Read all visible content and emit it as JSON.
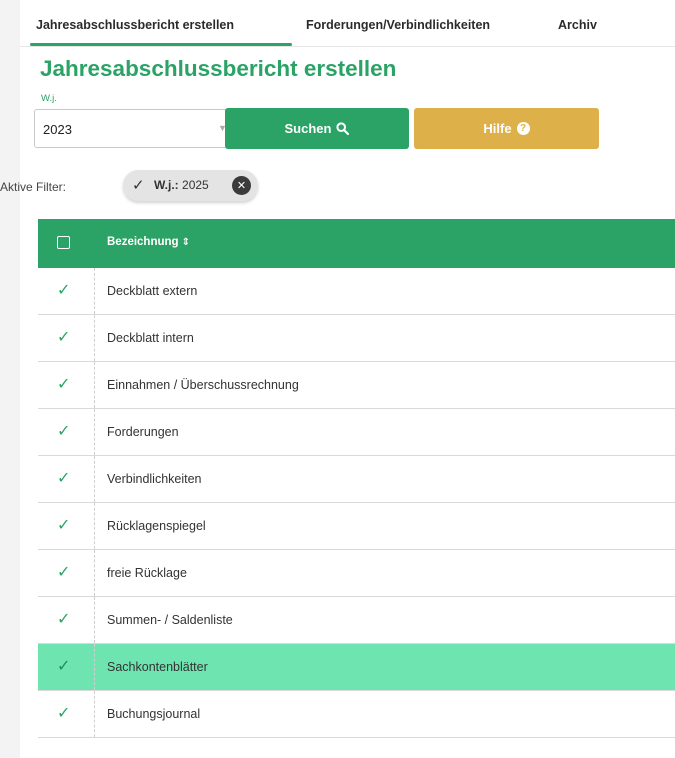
{
  "tabs": [
    {
      "label": "Jahresabschlussbericht erstellen",
      "active": true
    },
    {
      "label": "Forderungen/Verbindlichkeiten",
      "active": false
    },
    {
      "label": "Archiv",
      "active": false
    }
  ],
  "page_title": "Jahresabschlussbericht erstellen",
  "filter_form": {
    "wj_label": "W.j.",
    "wj_value": "2023",
    "search_label": "Suchen",
    "help_label": "Hilfe"
  },
  "active_filters": {
    "label": "Aktive Filter:",
    "chip_key": "W.j.:",
    "chip_value": "2025"
  },
  "table": {
    "header": "Bezeichnung",
    "rows": [
      {
        "label": "Deckblatt extern",
        "checked": true
      },
      {
        "label": "Deckblatt intern",
        "checked": true
      },
      {
        "label": "Einnahmen / Überschussrechnung",
        "checked": true
      },
      {
        "label": "Forderungen",
        "checked": true
      },
      {
        "label": "Verbindlichkeiten",
        "checked": true
      },
      {
        "label": "Rücklagenspiegel",
        "checked": true
      },
      {
        "label": "freie Rücklage",
        "checked": true
      },
      {
        "label": "Summen- / Saldenliste",
        "checked": true
      },
      {
        "label": "Sachkontenblätter",
        "checked": true,
        "highlighted": true
      },
      {
        "label": "Buchungsjournal",
        "checked": true
      }
    ]
  },
  "colors": {
    "primary_green": "#2ba366",
    "help_yellow": "#deb04a",
    "row_highlight": "#6ee4b0",
    "chip_background": "#e4e4e4"
  },
  "icons": {
    "search": "search-icon",
    "help": "question-circle-icon",
    "chip_check": "check-icon",
    "chip_remove": "close-circle-icon",
    "sort": "sort-icon",
    "row_check": "check-icon"
  }
}
